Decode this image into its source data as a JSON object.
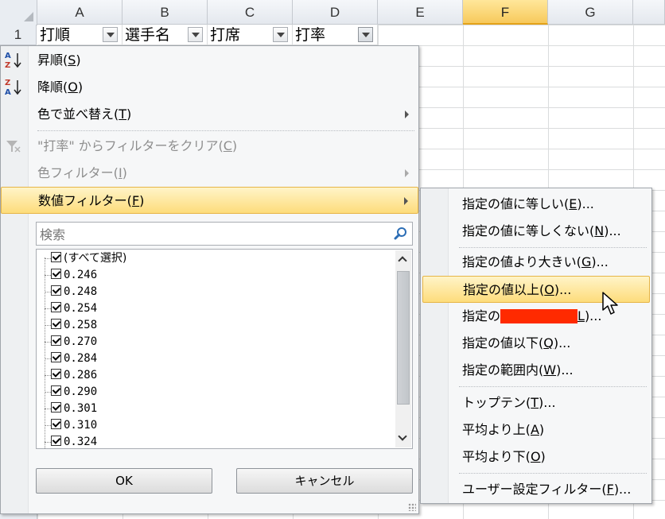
{
  "sheet": {
    "columns": [
      "A",
      "B",
      "C",
      "D",
      "E",
      "F",
      "G"
    ],
    "active_column": "F",
    "rows": [
      "1"
    ],
    "header_row": [
      "打順",
      "選手名",
      "打席",
      "打率"
    ]
  },
  "menu": {
    "sort_asc": {
      "text": "昇順(",
      "key": "S",
      "close": ")"
    },
    "sort_desc": {
      "text": "降順(",
      "key": "O",
      "close": ")"
    },
    "sort_color": {
      "text": "色で並べ替え(",
      "key": "T",
      "close": ")"
    },
    "clear_filter": {
      "text": "\"打率\" からフィルターをクリア(",
      "key": "C",
      "close": ")"
    },
    "color_filter": {
      "text": "色フィルター(",
      "key": "I",
      "close": ")"
    },
    "number_filter": {
      "text": "数値フィルター(",
      "key": "F",
      "close": ")"
    },
    "search_placeholder": "検索",
    "list": [
      "(すべて選択)",
      "0.246",
      "0.248",
      "0.254",
      "0.258",
      "0.270",
      "0.284",
      "0.286",
      "0.290",
      "0.301",
      "0.310",
      "0.324"
    ],
    "ok_label": "OK",
    "cancel_label": "キャンセル"
  },
  "submenu": {
    "items": [
      {
        "pre": "指定の値に等しい(",
        "key": "E",
        "post": ")..."
      },
      {
        "pre": "指定の値に等しくない(",
        "key": "N",
        "post": ")..."
      },
      {
        "pre": "指定の値より大きい(",
        "key": "G",
        "post": ")..."
      },
      {
        "pre": "指定の値以上(",
        "key": "O",
        "post": ")..."
      },
      {
        "pre": "指定の",
        "key": "L",
        "post": ")..."
      },
      {
        "pre": "指定の値以下(",
        "key": "Q",
        "post": ")..."
      },
      {
        "pre": "指定の範囲内(",
        "key": "W",
        "post": ")..."
      },
      {
        "pre": "トップテン(",
        "key": "T",
        "post": ")..."
      },
      {
        "pre": "平均より上(",
        "key": "A",
        "post": ")"
      },
      {
        "pre": "平均より下(",
        "key": "O",
        "post": ")"
      },
      {
        "pre": "ユーザー設定フィルター(",
        "key": "F",
        "post": ")..."
      }
    ]
  },
  "colors": {
    "highlight_top": "#fff4c8",
    "highlight_bottom": "#fddc7b",
    "highlight_border": "#e6b547",
    "redaction": "#ff2a00"
  }
}
